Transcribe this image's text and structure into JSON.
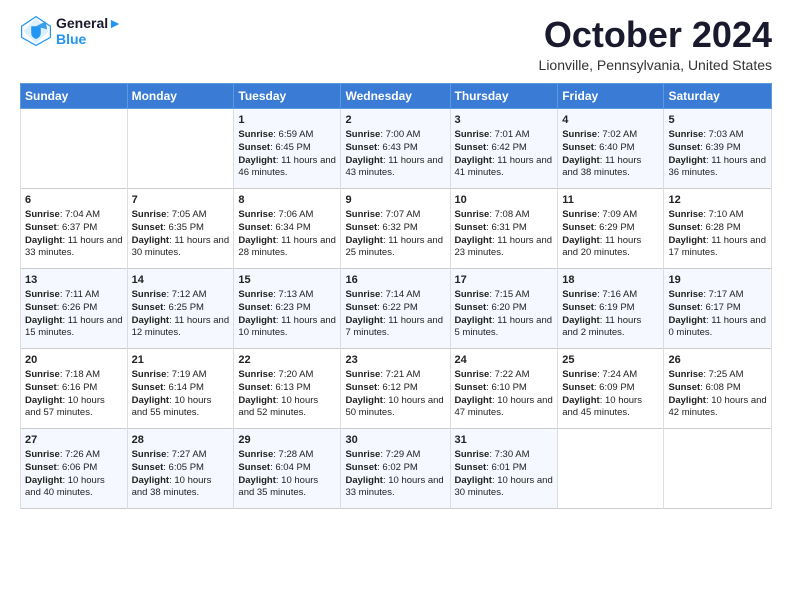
{
  "header": {
    "logo_line1": "General",
    "logo_line2": "Blue",
    "month_title": "October 2024",
    "location": "Lionville, Pennsylvania, United States"
  },
  "days_of_week": [
    "Sunday",
    "Monday",
    "Tuesday",
    "Wednesday",
    "Thursday",
    "Friday",
    "Saturday"
  ],
  "weeks": [
    [
      {
        "day": "",
        "content": ""
      },
      {
        "day": "",
        "content": ""
      },
      {
        "day": "1",
        "content": "Sunrise: 6:59 AM\nSunset: 6:45 PM\nDaylight: 11 hours and 46 minutes."
      },
      {
        "day": "2",
        "content": "Sunrise: 7:00 AM\nSunset: 6:43 PM\nDaylight: 11 hours and 43 minutes."
      },
      {
        "day": "3",
        "content": "Sunrise: 7:01 AM\nSunset: 6:42 PM\nDaylight: 11 hours and 41 minutes."
      },
      {
        "day": "4",
        "content": "Sunrise: 7:02 AM\nSunset: 6:40 PM\nDaylight: 11 hours and 38 minutes."
      },
      {
        "day": "5",
        "content": "Sunrise: 7:03 AM\nSunset: 6:39 PM\nDaylight: 11 hours and 36 minutes."
      }
    ],
    [
      {
        "day": "6",
        "content": "Sunrise: 7:04 AM\nSunset: 6:37 PM\nDaylight: 11 hours and 33 minutes."
      },
      {
        "day": "7",
        "content": "Sunrise: 7:05 AM\nSunset: 6:35 PM\nDaylight: 11 hours and 30 minutes."
      },
      {
        "day": "8",
        "content": "Sunrise: 7:06 AM\nSunset: 6:34 PM\nDaylight: 11 hours and 28 minutes."
      },
      {
        "day": "9",
        "content": "Sunrise: 7:07 AM\nSunset: 6:32 PM\nDaylight: 11 hours and 25 minutes."
      },
      {
        "day": "10",
        "content": "Sunrise: 7:08 AM\nSunset: 6:31 PM\nDaylight: 11 hours and 23 minutes."
      },
      {
        "day": "11",
        "content": "Sunrise: 7:09 AM\nSunset: 6:29 PM\nDaylight: 11 hours and 20 minutes."
      },
      {
        "day": "12",
        "content": "Sunrise: 7:10 AM\nSunset: 6:28 PM\nDaylight: 11 hours and 17 minutes."
      }
    ],
    [
      {
        "day": "13",
        "content": "Sunrise: 7:11 AM\nSunset: 6:26 PM\nDaylight: 11 hours and 15 minutes."
      },
      {
        "day": "14",
        "content": "Sunrise: 7:12 AM\nSunset: 6:25 PM\nDaylight: 11 hours and 12 minutes."
      },
      {
        "day": "15",
        "content": "Sunrise: 7:13 AM\nSunset: 6:23 PM\nDaylight: 11 hours and 10 minutes."
      },
      {
        "day": "16",
        "content": "Sunrise: 7:14 AM\nSunset: 6:22 PM\nDaylight: 11 hours and 7 minutes."
      },
      {
        "day": "17",
        "content": "Sunrise: 7:15 AM\nSunset: 6:20 PM\nDaylight: 11 hours and 5 minutes."
      },
      {
        "day": "18",
        "content": "Sunrise: 7:16 AM\nSunset: 6:19 PM\nDaylight: 11 hours and 2 minutes."
      },
      {
        "day": "19",
        "content": "Sunrise: 7:17 AM\nSunset: 6:17 PM\nDaylight: 11 hours and 0 minutes."
      }
    ],
    [
      {
        "day": "20",
        "content": "Sunrise: 7:18 AM\nSunset: 6:16 PM\nDaylight: 10 hours and 57 minutes."
      },
      {
        "day": "21",
        "content": "Sunrise: 7:19 AM\nSunset: 6:14 PM\nDaylight: 10 hours and 55 minutes."
      },
      {
        "day": "22",
        "content": "Sunrise: 7:20 AM\nSunset: 6:13 PM\nDaylight: 10 hours and 52 minutes."
      },
      {
        "day": "23",
        "content": "Sunrise: 7:21 AM\nSunset: 6:12 PM\nDaylight: 10 hours and 50 minutes."
      },
      {
        "day": "24",
        "content": "Sunrise: 7:22 AM\nSunset: 6:10 PM\nDaylight: 10 hours and 47 minutes."
      },
      {
        "day": "25",
        "content": "Sunrise: 7:24 AM\nSunset: 6:09 PM\nDaylight: 10 hours and 45 minutes."
      },
      {
        "day": "26",
        "content": "Sunrise: 7:25 AM\nSunset: 6:08 PM\nDaylight: 10 hours and 42 minutes."
      }
    ],
    [
      {
        "day": "27",
        "content": "Sunrise: 7:26 AM\nSunset: 6:06 PM\nDaylight: 10 hours and 40 minutes."
      },
      {
        "day": "28",
        "content": "Sunrise: 7:27 AM\nSunset: 6:05 PM\nDaylight: 10 hours and 38 minutes."
      },
      {
        "day": "29",
        "content": "Sunrise: 7:28 AM\nSunset: 6:04 PM\nDaylight: 10 hours and 35 minutes."
      },
      {
        "day": "30",
        "content": "Sunrise: 7:29 AM\nSunset: 6:02 PM\nDaylight: 10 hours and 33 minutes."
      },
      {
        "day": "31",
        "content": "Sunrise: 7:30 AM\nSunset: 6:01 PM\nDaylight: 10 hours and 30 minutes."
      },
      {
        "day": "",
        "content": ""
      },
      {
        "day": "",
        "content": ""
      }
    ]
  ]
}
